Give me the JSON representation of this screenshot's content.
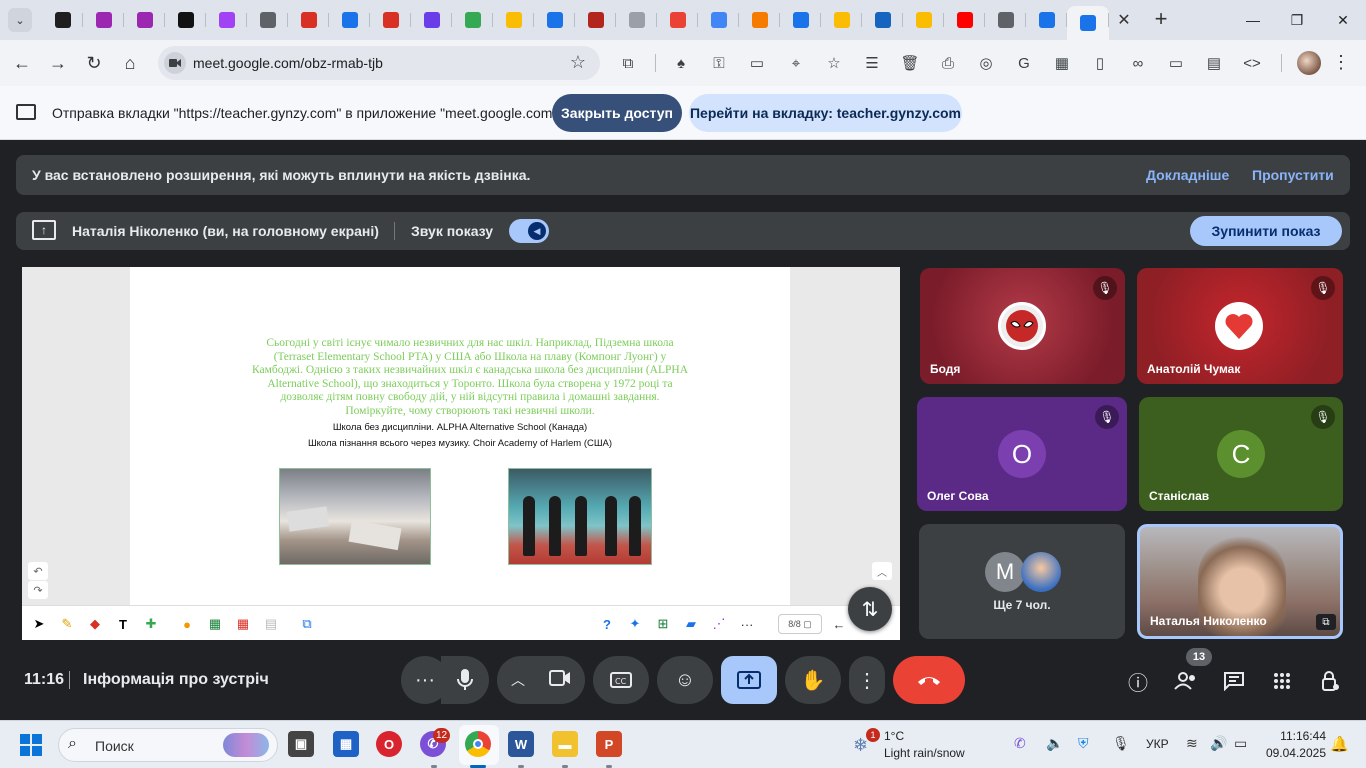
{
  "browser": {
    "tab_favicons": [
      {
        "name": "tab-favicon-1",
        "color": "#1f1f1f"
      },
      {
        "name": "tab-favicon-2",
        "color": "#9c27b0"
      },
      {
        "name": "tab-favicon-3",
        "color": "#9c27b0"
      },
      {
        "name": "tab-favicon-4",
        "color": "#111111"
      },
      {
        "name": "tab-favicon-5",
        "color": "#a142f4"
      },
      {
        "name": "tab-favicon-6",
        "color": "#5f6368"
      },
      {
        "name": "tab-favicon-7",
        "color": "#d93025"
      },
      {
        "name": "tab-favicon-8",
        "color": "#1a73e8"
      },
      {
        "name": "tab-favicon-9",
        "color": "#d93025"
      },
      {
        "name": "tab-favicon-10",
        "color": "#6a3de8"
      },
      {
        "name": "tab-favicon-11",
        "color": "#34a853"
      },
      {
        "name": "tab-favicon-12",
        "color": "#fbbc04"
      },
      {
        "name": "tab-favicon-13",
        "color": "#1a73e8"
      },
      {
        "name": "tab-favicon-14",
        "color": "#b3261e"
      },
      {
        "name": "tab-favicon-15",
        "color": "#9aa0a6"
      },
      {
        "name": "tab-favicon-16",
        "color": "#ea4335"
      },
      {
        "name": "tab-favicon-17",
        "color": "#4285f4"
      },
      {
        "name": "tab-favicon-18",
        "color": "#f57c00"
      },
      {
        "name": "tab-favicon-19",
        "color": "#1a73e8"
      },
      {
        "name": "tab-favicon-20",
        "color": "#fbbc04"
      },
      {
        "name": "tab-favicon-21",
        "color": "#1565c0"
      },
      {
        "name": "tab-favicon-22",
        "color": "#fbbc04"
      },
      {
        "name": "tab-favicon-23",
        "color": "#ff0000"
      },
      {
        "name": "tab-favicon-24",
        "color": "#5f6368"
      },
      {
        "name": "tab-favicon-25",
        "color": "#1a73e8"
      },
      {
        "name": "tab-favicon-26",
        "color": "#1a73e8"
      }
    ],
    "url": "meet.google.com/obz-rmab-tjb"
  },
  "infobar": {
    "text": "Отправка вкладки \"https://teacher.gynzy.com\" в приложение \"meet.google.com\"...",
    "stop_button": "Закрыть доступ",
    "goto_button": "Перейти на вкладку: teacher.gynzy.com"
  },
  "meet": {
    "warning": {
      "text": "У вас встановлено розширення, які можуть вплинути на якість дзвінка.",
      "learn_more": "Докладніше",
      "skip": "Пропустити"
    },
    "presenting": {
      "name": "Наталія Ніколенко (ви, на головному екрані)",
      "sound_label": "Звук показу",
      "stop_label": "Зупинити показ"
    },
    "slide": {
      "paragraph": "Сьогодні у світі існує чимало незвичних для нас шкіл. Наприклад, Підземна школа (Terraset Elementary School PTA) у США або Школа на плаву (Компонг Луонг) у Камбоджі. Однією з таких незвичайних шкіл є канадська школа без дисципліни (ALPHA Alternative School), що знаходиться у Торонто. Школа була створена у 1972 році та дозволяє дітям повну свободу дій, у ній відсутні правила і домашні завдання. Поміркуйте, чому створюють такі незвичні школи.",
      "line1": "Школа без дисципліни. ALPHA Alternative School (Канада)",
      "line2": "Школа пізнання всього через музику. Choir Academy of Harlem (США)",
      "page": "8/8"
    },
    "participants": [
      {
        "name": "Бодя",
        "bg": "#8a2230"
      },
      {
        "name": "Анатолій Чумак",
        "bg": "#8e1f25"
      },
      {
        "name": "Олег Сова",
        "initial": "О",
        "bg": "#5b2a86",
        "avatar": "#7b3fb0"
      },
      {
        "name": "Станіслав",
        "initial": "С",
        "bg": "#3c5e1f",
        "avatar": "#5c8f2e"
      },
      {
        "more_initial": "М",
        "more_label": "Ще 7 чол."
      },
      {
        "name": "Наталья Николенко"
      }
    ],
    "time": "11:16",
    "meeting_info": "Інформація про зустріч",
    "people_count": "13"
  },
  "taskbar": {
    "search_placeholder": "Поиск",
    "chat_badge": "12",
    "weather_badge": "1",
    "weather_temp": "1°C",
    "weather_desc": "Light rain/snow",
    "language": "УКР",
    "time": "11:16:44",
    "date": "09.04.2025"
  }
}
